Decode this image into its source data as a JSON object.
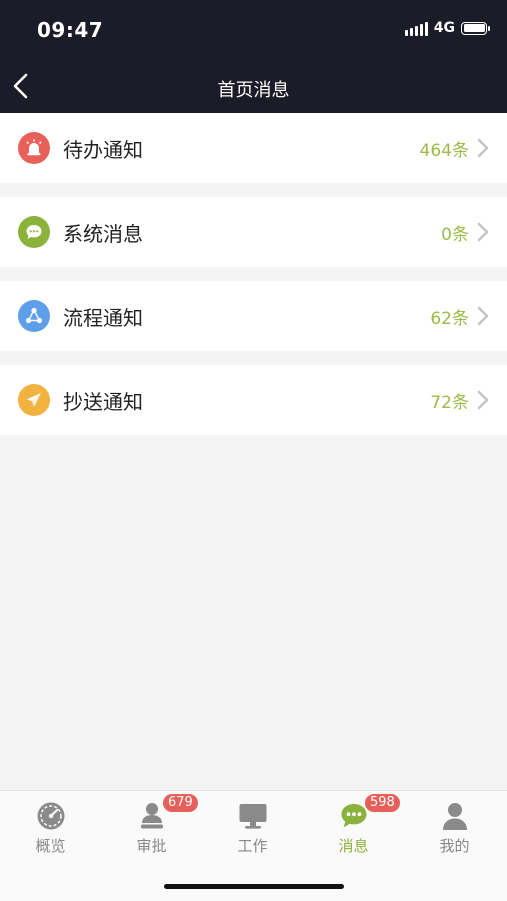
{
  "status_bar": {
    "time": "09:47",
    "network": "4G"
  },
  "header": {
    "title": "首页消息"
  },
  "items": [
    {
      "label": "待办通知",
      "count": "464条",
      "icon": "alarm-icon",
      "color": "#e8605a"
    },
    {
      "label": "系统消息",
      "count": "0条",
      "icon": "chat-bubble-icon",
      "color": "#8bb23a"
    },
    {
      "label": "流程通知",
      "count": "62条",
      "icon": "workflow-icon",
      "color": "#5f9ee8"
    },
    {
      "label": "抄送通知",
      "count": "72条",
      "icon": "paper-plane-icon",
      "color": "#f2b341"
    }
  ],
  "tabbar": {
    "tabs": [
      {
        "label": "概览",
        "icon": "dashboard-icon",
        "badge": null,
        "active": false
      },
      {
        "label": "审批",
        "icon": "user-stamp-icon",
        "badge": "679",
        "active": false
      },
      {
        "label": "工作",
        "icon": "monitor-icon",
        "badge": null,
        "active": false
      },
      {
        "label": "消息",
        "icon": "chat-bubble-icon",
        "badge": "598",
        "active": true
      },
      {
        "label": "我的",
        "icon": "person-icon",
        "badge": null,
        "active": false
      }
    ]
  },
  "colors": {
    "accent": "#8bb23a",
    "count": "#9dba4a",
    "badge": "#e5605a",
    "header_bg": "#1c1c28"
  }
}
